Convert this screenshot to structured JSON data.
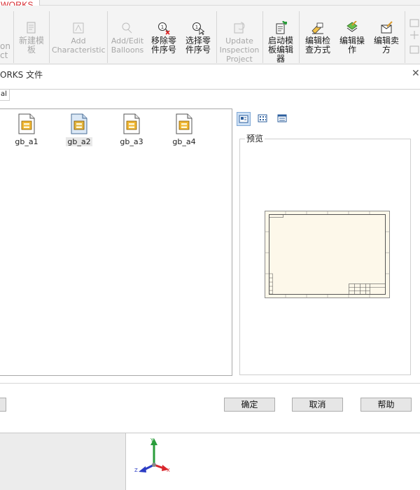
{
  "app": {
    "brand": "WORKS"
  },
  "toolbar": {
    "items": [
      {
        "label_1": "on",
        "label_2": "ct",
        "enabled": false
      },
      {
        "label_1": "新建模",
        "label_2": "板",
        "enabled": false,
        "icon": "new-template-icon"
      },
      {
        "label_1": "Add",
        "label_2": "Characteristic",
        "enabled": false,
        "icon": "add-characteristic-icon"
      },
      {
        "label_1": "Add/Edit",
        "label_2": "Balloons",
        "enabled": false,
        "icon": "balloons-icon"
      },
      {
        "label_1": "移除零",
        "label_2": "件序号",
        "enabled": true,
        "icon": "remove-balloon-icon"
      },
      {
        "label_1": "选择零",
        "label_2": "件序号",
        "enabled": true,
        "icon": "select-balloon-icon"
      },
      {
        "label_1": "Update",
        "label_2": "Inspection",
        "label_3": "Project",
        "enabled": false,
        "icon": "update-inspection-icon"
      },
      {
        "label_1": "启动模",
        "label_2": "板编辑",
        "label_3": "器",
        "enabled": true,
        "icon": "template-editor-icon"
      },
      {
        "label_1": "编辑检",
        "label_2": "查方式",
        "enabled": true,
        "icon": "edit-inspection-method-icon"
      },
      {
        "label_1": "编辑操",
        "label_2": "作",
        "enabled": true,
        "icon": "edit-operation-icon"
      },
      {
        "label_1": "编辑卖",
        "label_2": "方",
        "enabled": true,
        "icon": "edit-vendor-icon"
      }
    ]
  },
  "dialog": {
    "title": "ORKS 文件",
    "tab_label": "al",
    "files": [
      {
        "name": "gb_a1",
        "selected": false
      },
      {
        "name": "gb_a2",
        "selected": true
      },
      {
        "name": "gb_a3",
        "selected": false
      },
      {
        "name": "gb_a4",
        "selected": false
      }
    ],
    "view_modes": [
      "large-icons",
      "list",
      "details"
    ],
    "active_view": "large-icons",
    "preview_label": "预览",
    "buttons": {
      "ok": "确定",
      "cancel": "取消",
      "help": "帮助"
    }
  },
  "triad": {
    "x": "X",
    "y": "Y",
    "z": "Z"
  },
  "colors": {
    "brand_red": "#d7262c",
    "axis_x": "#d9262c",
    "axis_y": "#2a9d3b",
    "axis_z": "#2b3cc4",
    "sheet_fill": "#fdf8ea"
  }
}
